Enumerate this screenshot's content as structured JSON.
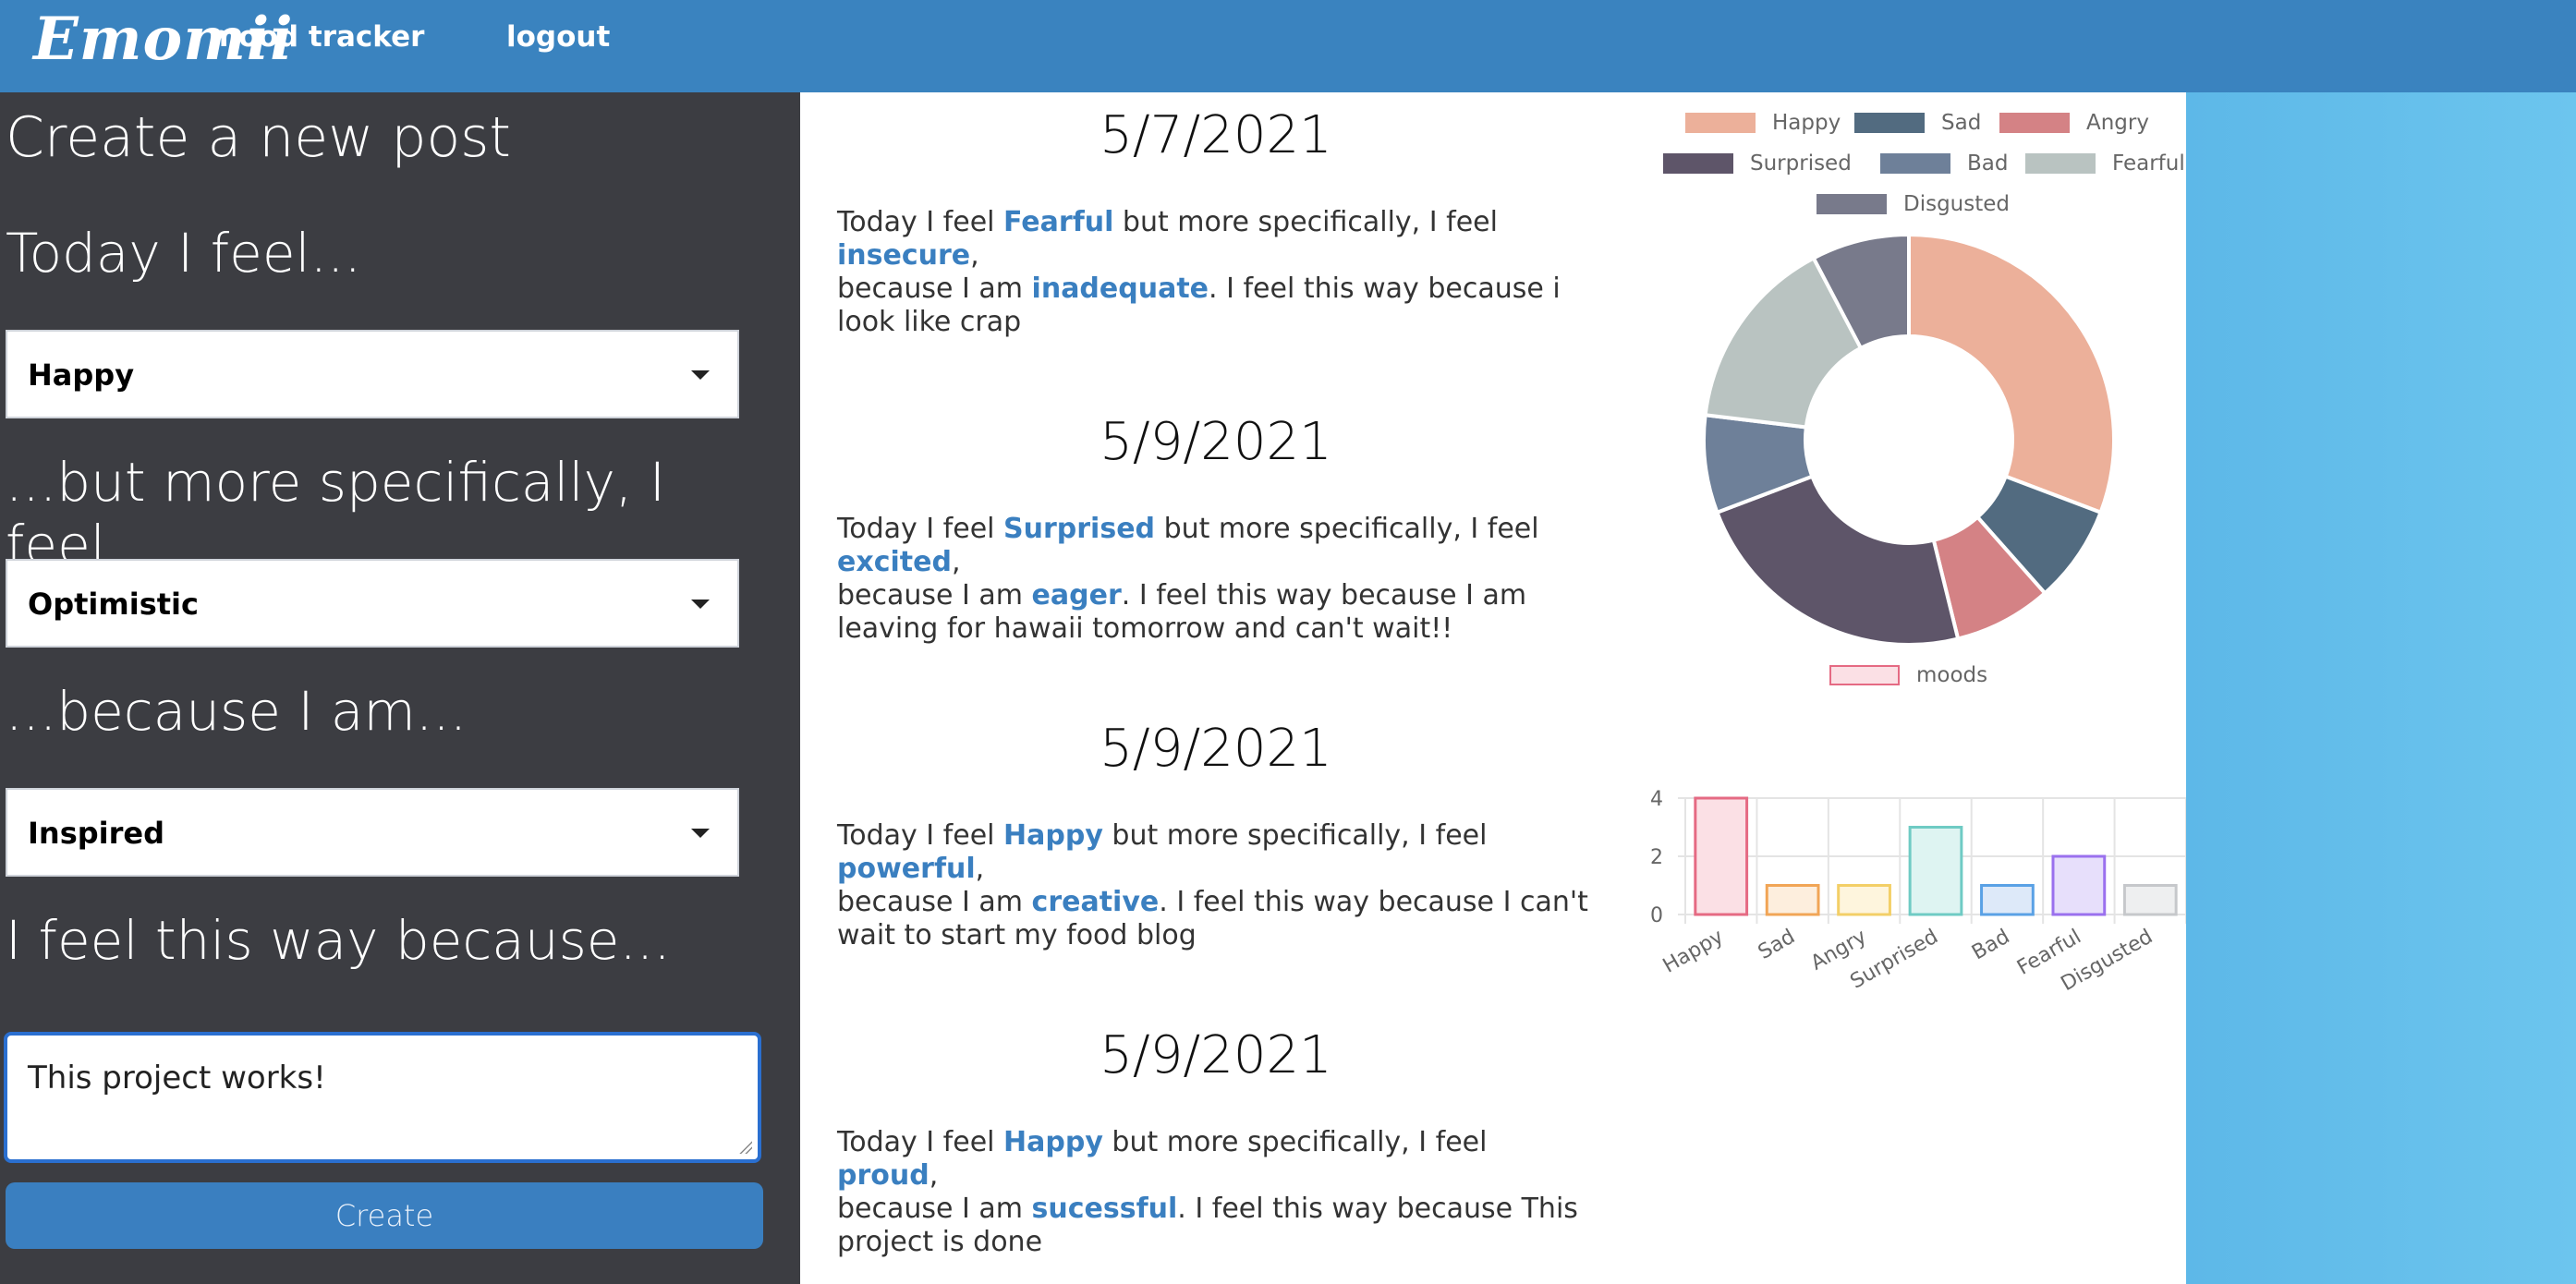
{
  "header": {
    "brand_logo": "Emomii",
    "brand_sub": "mood tracker",
    "logout": "logout"
  },
  "form": {
    "title": "Create a new post",
    "feel_label": "Today I feel...",
    "feel_value": "Happy",
    "specific_label": "...but more specifically, I feel...",
    "specific_value": "Optimistic",
    "because_label": "...because I am...",
    "because_value": "Inspired",
    "reason_label": "I feel this way because...",
    "reason_value": "This project works!",
    "create_label": "Create"
  },
  "posts": [
    {
      "date": "5/7/2021",
      "mood": "Fearful",
      "specific": "insecure",
      "because": "inadequate",
      "reason": "i look like crap"
    },
    {
      "date": "5/9/2021",
      "mood": "Surprised",
      "specific": "excited",
      "because": "eager",
      "reason": "I am leaving for hawaii tomorrow and can't wait!!"
    },
    {
      "date": "5/9/2021",
      "mood": "Happy",
      "specific": "powerful",
      "because": "creative",
      "reason": "I can't wait to start my food blog"
    },
    {
      "date": "5/9/2021",
      "mood": "Happy",
      "specific": "proud",
      "because": "sucessful",
      "reason": "This project is done"
    }
  ],
  "post_text": {
    "prefix": "Today I feel ",
    "mid1": " but more specifically, I feel ",
    "mid2": ",",
    "mid3": "because I am ",
    "mid4": ". I feel this way because "
  },
  "chart_data": [
    {
      "type": "pie",
      "legend_position": "top",
      "labels": [
        "Happy",
        "Sad",
        "Angry",
        "Surprised",
        "Bad",
        "Fearful",
        "Disgusted"
      ],
      "values": [
        4,
        1,
        1,
        3,
        1,
        2,
        1
      ],
      "colors": [
        "#ecb09a",
        "#526b80",
        "#d48285",
        "#5e5569",
        "#6e8099",
        "#b9c3c1",
        "#787a8b"
      ]
    },
    {
      "type": "bar",
      "legend": "moods",
      "categories": [
        "Happy",
        "Sad",
        "Angry",
        "Surprised",
        "Bad",
        "Fearful",
        "Disgusted"
      ],
      "values": [
        4,
        1,
        1,
        3,
        1,
        2,
        1
      ],
      "ylim": [
        0,
        4
      ],
      "yticks": [
        0,
        2,
        4
      ],
      "fills": [
        "#fbe0e5",
        "#fdeedd",
        "#fef5dd",
        "#def4f2",
        "#dde9f9",
        "#e7dffb",
        "#eeeff0"
      ],
      "strokes": [
        "#e56a83",
        "#f1a556",
        "#f3cf67",
        "#6fcbc4",
        "#5aa1e5",
        "#9a70ee",
        "#c6c8cb"
      ]
    }
  ]
}
